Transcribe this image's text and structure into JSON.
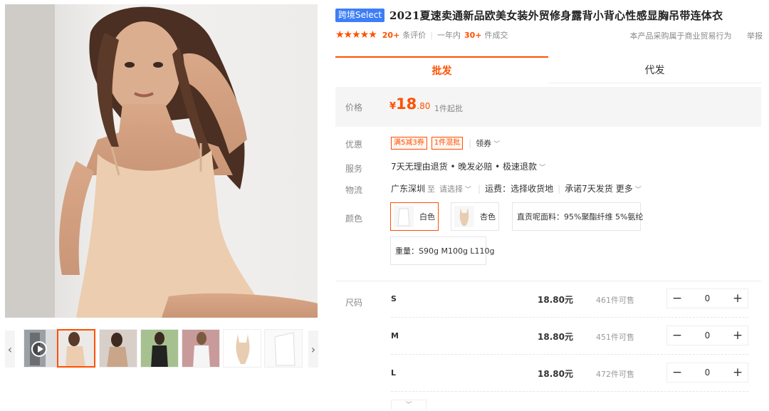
{
  "gallery": {
    "thumbnails": [
      "video",
      "beige-front",
      "model-2",
      "model-3",
      "model-4",
      "product-beige",
      "product-white"
    ],
    "active_index": 1
  },
  "title": {
    "badge": "跨境Select",
    "text": "2021夏速卖通新品欧美女装外贸修身露背小背心性感显胸吊带连体衣"
  },
  "meta": {
    "stars": "★★★★★",
    "review_count": "20+",
    "review_label": "条评价",
    "year_label": "一年内",
    "sold_count": "30+",
    "sold_label": "件成交",
    "notice": "本产品采购属于商业贸易行为",
    "report": "举报"
  },
  "tabs": [
    {
      "label": "批发"
    },
    {
      "label": "代发"
    }
  ],
  "price": {
    "label": "价格",
    "currency": "¥",
    "integer": "18",
    "decimal": ".80",
    "min_order": "1件起批"
  },
  "coupon": {
    "label": "优惠",
    "tags": [
      "满5减3券",
      "1件混批"
    ],
    "get_label": "领券"
  },
  "service": {
    "label": "服务",
    "text": "7天无理由退货 • 晚发必赔 • 极速退款"
  },
  "shipping": {
    "label": "物流",
    "from": "广东深圳",
    "to_prefix": "至",
    "to_placeholder": "请选择",
    "fee": "运费：选择收货地",
    "promise": "承诺7天发货",
    "more": "更多"
  },
  "color": {
    "label": "颜色",
    "options": [
      {
        "name": "白色",
        "selected": true
      },
      {
        "name": "杏色",
        "selected": false
      }
    ],
    "material": "直贡呢面料：95%聚酯纤维 5%氨纶",
    "weight": "重量：S90g M100g L110g"
  },
  "sizes": {
    "label": "尺码",
    "rows": [
      {
        "size": "S",
        "price": "18.80元",
        "stock": "461件可售",
        "qty": "0"
      },
      {
        "size": "M",
        "price": "18.80元",
        "stock": "451件可售",
        "qty": "0"
      },
      {
        "size": "L",
        "price": "18.80元",
        "stock": "472件可售",
        "qty": "0"
      }
    ]
  },
  "icons": {
    "prev": "chevron-left-icon",
    "next": "chevron-right-icon",
    "play": "play-icon",
    "minus": "minus-icon",
    "plus": "plus-icon",
    "expand": "chevron-down-icon"
  },
  "colors": {
    "accent": "#ff5000",
    "badge_blue": "#3d7df7",
    "price_bg": "#f5f5f5"
  }
}
